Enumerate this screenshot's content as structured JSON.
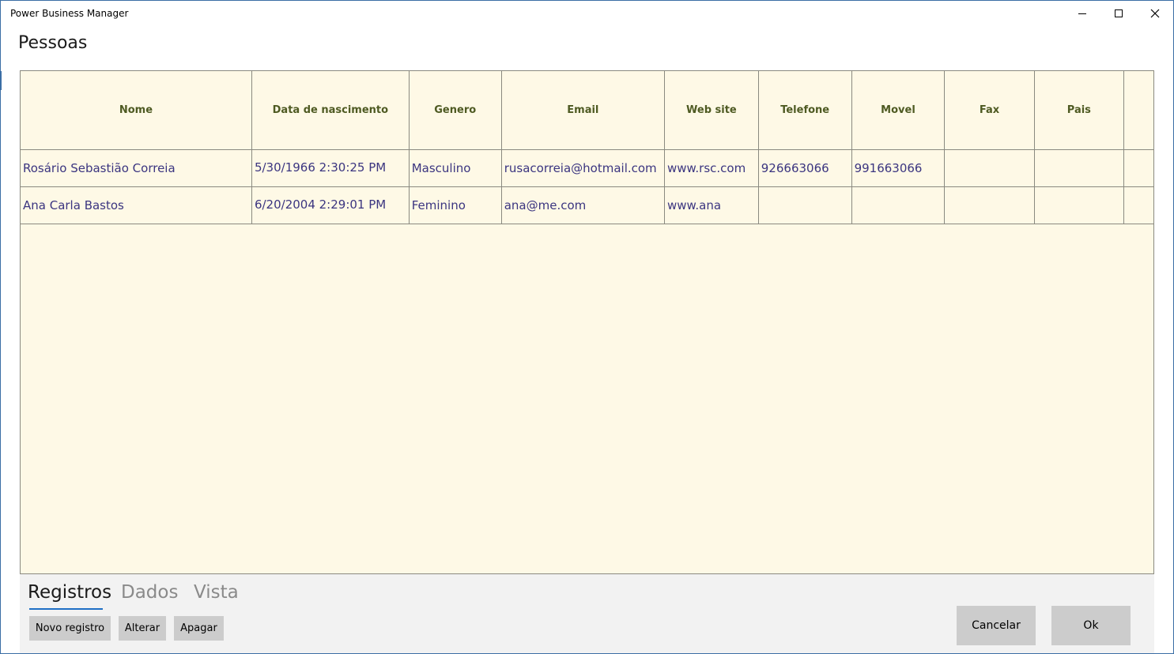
{
  "window": {
    "title": "Power Business Manager",
    "controls": [
      "minimize",
      "maximize",
      "close"
    ]
  },
  "page": {
    "title": "Pessoas"
  },
  "grid": {
    "columns": [
      "Nome",
      "Data de nascimento",
      "Genero",
      "Email",
      "Web site",
      "Telefone",
      "Movel",
      "Fax",
      "Pais"
    ],
    "rows": [
      {
        "nome": "Rosário Sebastião Correia",
        "data_nascimento": "5/30/1966 2:30:25 PM",
        "genero": "Masculino",
        "email": "rusacorreia@hotmail.com",
        "web_site": "www.rsc.com",
        "telefone": "926663066",
        "movel": "991663066",
        "fax": "",
        "pais": ""
      },
      {
        "nome": "Ana Carla Bastos",
        "data_nascimento": "6/20/2004 2:29:01 PM",
        "genero": "Feminino",
        "email": "ana@me.com",
        "web_site": "www.ana",
        "telefone": "",
        "movel": "",
        "fax": "",
        "pais": ""
      }
    ]
  },
  "tabs": [
    {
      "label": "Registros",
      "active": true
    },
    {
      "label": "Dados",
      "active": false
    },
    {
      "label": "Vista",
      "active": false
    }
  ],
  "actions": {
    "novo_registro": "Novo registro",
    "alterar": "Alterar",
    "apagar": "Apagar",
    "cancelar": "Cancelar",
    "ok": "Ok"
  },
  "colors": {
    "grid_background": "#fef9e6",
    "header_text": "#4e5a22",
    "cell_text": "#3b3580",
    "tab_accent": "#1f6fc5",
    "button_background": "#cccccc"
  }
}
